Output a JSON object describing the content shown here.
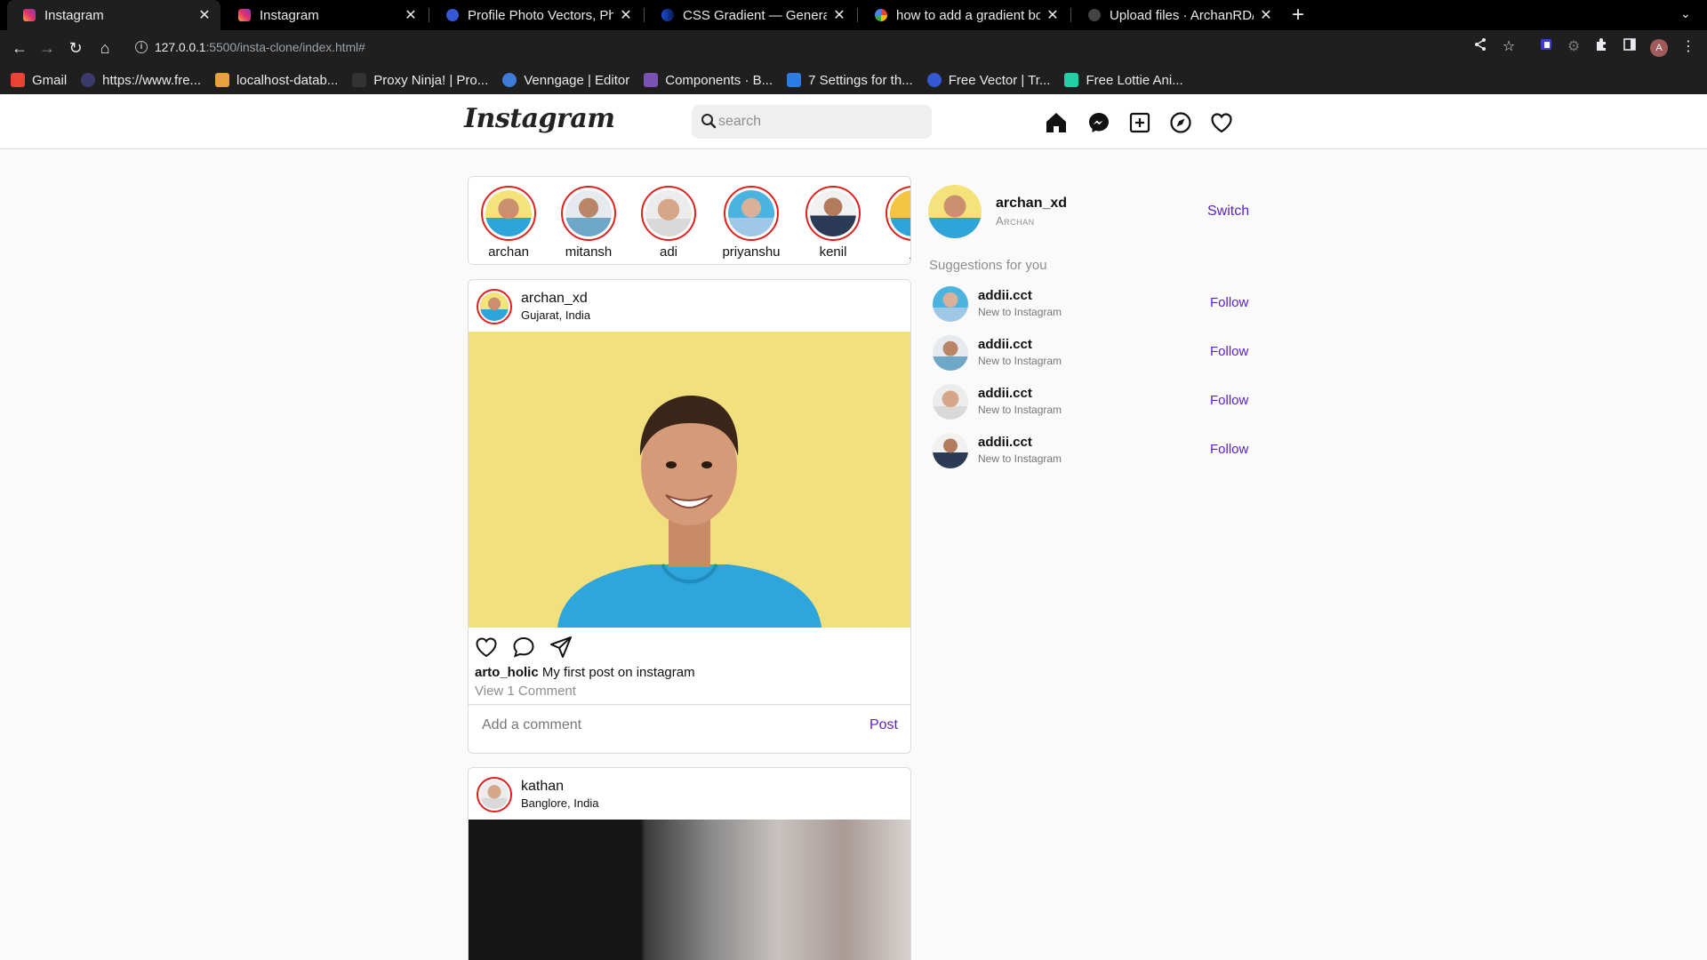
{
  "browser": {
    "tabs": [
      {
        "title": "Instagram",
        "active": true
      },
      {
        "title": "Instagram",
        "active": false
      },
      {
        "title": "Profile Photo Vectors, Phot",
        "active": false
      },
      {
        "title": "CSS Gradient — Generator",
        "active": false
      },
      {
        "title": "how to add a gradient bord",
        "active": false
      },
      {
        "title": "Upload files · ArchanRD/fro",
        "active": false
      }
    ],
    "url_host": "127.0.0.1",
    "url_rest": ":5500/insta-clone/index.html#",
    "profile_initial": "A",
    "bookmarks": [
      {
        "label": "Gmail",
        "color": "#ea4335"
      },
      {
        "label": "https://www.fre...",
        "color": "#3b3b6b"
      },
      {
        "label": "localhost-datab...",
        "color": "#e8a23a"
      },
      {
        "label": "Proxy Ninja! | Pro...",
        "color": "#333333"
      },
      {
        "label": "Venngage | Editor",
        "color": "#3d7bd9"
      },
      {
        "label": "Components · B...",
        "color": "#7952b3"
      },
      {
        "label": "7 Settings for th...",
        "color": "#2d7be5"
      },
      {
        "label": "Free Vector | Tr...",
        "color": "#3558d4"
      },
      {
        "label": "Free Lottie Ani...",
        "color": "#1fd1a5"
      }
    ]
  },
  "app": {
    "logo": "Instagram",
    "search_placeholder": "search",
    "nav_icons": [
      "home-icon",
      "messenger-icon",
      "new-post-icon",
      "explore-icon",
      "heart-icon"
    ],
    "accent_color": "#5b21c9",
    "story_ring_color": "#e0201d"
  },
  "stories": [
    {
      "name": "archan"
    },
    {
      "name": "mitansh"
    },
    {
      "name": "adi"
    },
    {
      "name": "priyanshu"
    },
    {
      "name": "kenil"
    },
    {
      "name": "ji"
    }
  ],
  "posts": [
    {
      "username": "archan_xd",
      "location": "Gujarat, India",
      "caption_user": "arto_holic",
      "caption_text": "My first post on instagram",
      "view_comments": "View 1 Comment",
      "comment_placeholder": "Add a comment",
      "post_label": "Post"
    },
    {
      "username": "kathan",
      "location": "Banglore, India"
    }
  ],
  "sidebar": {
    "username": "archan_xd",
    "name": "Archan",
    "switch_label": "Switch",
    "suggestions_title": "Suggestions for you",
    "suggestions": [
      {
        "username": "addii.cct",
        "subtitle": "New to Instagram",
        "action": "Follow"
      },
      {
        "username": "addii.cct",
        "subtitle": "New to Instagram",
        "action": "Follow"
      },
      {
        "username": "addii.cct",
        "subtitle": "New to Instagram",
        "action": "Follow"
      },
      {
        "username": "addii.cct",
        "subtitle": "New to Instagram",
        "action": "Follow"
      }
    ]
  }
}
